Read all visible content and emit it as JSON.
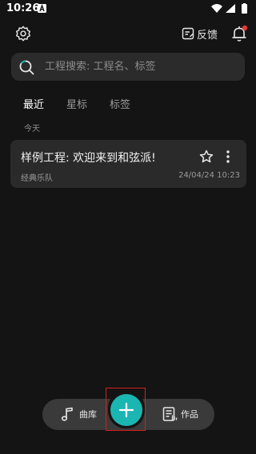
{
  "status_bar": {
    "time": "10:26"
  },
  "header": {
    "feedback_label": "反馈"
  },
  "search": {
    "placeholder": "工程搜索: 工程名、标签"
  },
  "tabs": [
    {
      "label": "最近",
      "active": true
    },
    {
      "label": "星标",
      "active": false
    },
    {
      "label": "标签",
      "active": false
    }
  ],
  "section": {
    "label": "今天"
  },
  "projects": [
    {
      "title": "样例工程: 欢迎来到和弦派!",
      "subtitle": "经典乐队",
      "date": "24/04/24 10:23",
      "starred": false
    }
  ],
  "bottom_nav": {
    "library_label": "曲库",
    "works_label": "作品",
    "add_icon": "plus-icon"
  },
  "colors": {
    "background": "#141414",
    "card": "#2a2a2a",
    "accent": "#1bb6b2",
    "highlight_frame": "#d61e1e"
  }
}
